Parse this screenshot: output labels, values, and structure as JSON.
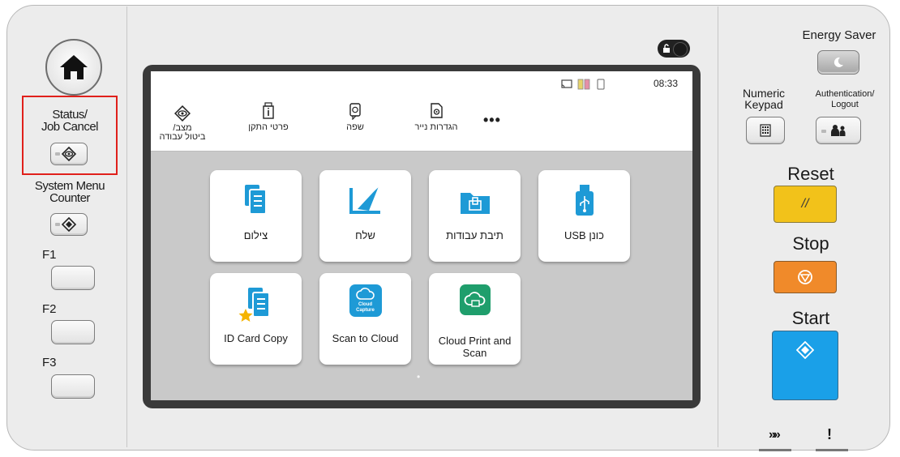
{
  "left_panel": {
    "status_label": "Status/\nJob Cancel",
    "system_menu_label": "System Menu\nCounter",
    "f1_label": "F1",
    "f2_label": "F2",
    "f3_label": "F3"
  },
  "lock_toggle_icon": "unlock-icon",
  "screen": {
    "time": "08:33",
    "quick_actions": [
      {
        "label": "מצב/\nביטול עבודה",
        "icon": "eye-diamond-icon"
      },
      {
        "label": "פרטי התקן",
        "icon": "device-info-icon"
      },
      {
        "label": "שפה",
        "icon": "language-icon"
      },
      {
        "label": "הגדרות נייר",
        "icon": "paper-settings-icon"
      }
    ],
    "more": "•••",
    "apps": [
      {
        "label": "צילום",
        "icon": "copy-icon"
      },
      {
        "label": "שלח",
        "icon": "send-icon"
      },
      {
        "label": "תיבת עבודות",
        "icon": "job-box-icon"
      },
      {
        "label": "USB כונן",
        "icon": "usb-icon"
      },
      {
        "label": "ID Card Copy",
        "icon": "id-card-copy-icon"
      },
      {
        "label": "Scan to Cloud",
        "icon": "cloud-capture-icon",
        "icon_text": "Cloud\nCapture"
      },
      {
        "label": "Cloud Print and\nScan",
        "icon": "cloud-print-icon"
      }
    ],
    "page_indicator": "•"
  },
  "right_panel": {
    "energy_saver_label": "Energy Saver",
    "numeric_keypad_label": "Numeric\nKeypad",
    "auth_label": "Authentication/\nLogout",
    "reset_label": "Reset",
    "reset_symbol": "//",
    "stop_label": "Stop",
    "start_label": "Start",
    "processing_symbol": "»»",
    "attention_symbol": "!"
  },
  "colors": {
    "reset": "#f2c21a",
    "stop": "#f08a2a",
    "start": "#1aa0e8",
    "highlight": "#e0201b",
    "app_blue": "#1e9ad6",
    "app_green": "#1f9e6c"
  }
}
